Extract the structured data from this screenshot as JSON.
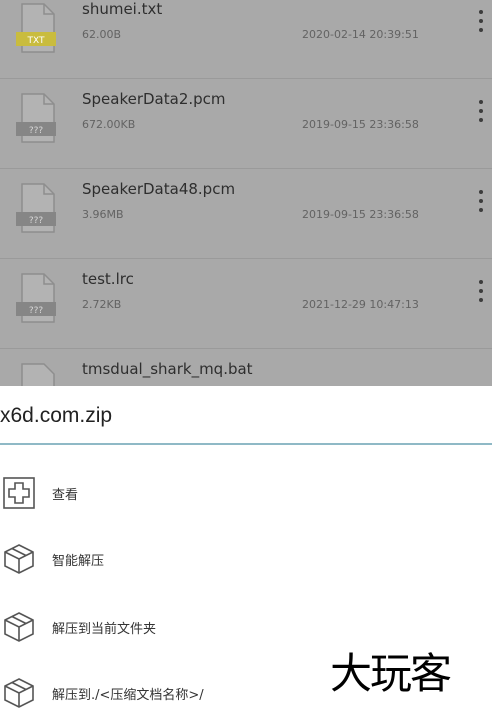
{
  "file_list": {
    "items": [
      {
        "name": "shumei.txt",
        "size": "62.00B",
        "date": "2020-02-14 20:39:51",
        "type_label": "TXT",
        "type_color": "#c9bc3e"
      },
      {
        "name": "SpeakerData2.pcm",
        "size": "672.00KB",
        "date": "2019-09-15 23:36:58",
        "type_label": "???",
        "type_color": "#868686"
      },
      {
        "name": "SpeakerData48.pcm",
        "size": "3.96MB",
        "date": "2019-09-15 23:36:58",
        "type_label": "???",
        "type_color": "#868686"
      },
      {
        "name": "test.lrc",
        "size": "2.72KB",
        "date": "2021-12-29 10:47:13",
        "type_label": "???",
        "type_color": "#868686"
      },
      {
        "name": "tmsdual_shark_mq.bat",
        "size": "",
        "date": "",
        "type_label": "",
        "type_color": "#868686"
      }
    ]
  },
  "sheet": {
    "title": "x6d.com.zip",
    "actions": [
      {
        "label": "查看",
        "icon": "plus-box-icon"
      },
      {
        "label": "智能解压",
        "icon": "package-icon"
      },
      {
        "label": "解压到当前文件夹",
        "icon": "package-icon"
      },
      {
        "label": "解压到./<压缩文档名称>/",
        "icon": "package-icon"
      }
    ]
  },
  "watermark": "大玩客",
  "colors": {
    "overlay": "#a9a9a9",
    "divider": "#8fb9c6",
    "txt_badge": "#c9bc3e",
    "unknown_badge": "#868686"
  }
}
